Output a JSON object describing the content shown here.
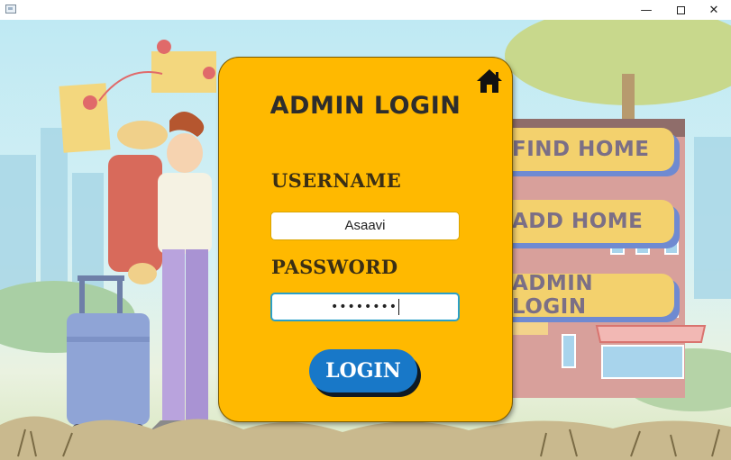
{
  "window": {
    "minimize_glyph": "—",
    "close_glyph": "✕"
  },
  "background_signs": [
    {
      "label": "FIND HOME"
    },
    {
      "label": "ADD HOME"
    },
    {
      "label": "ADMIN LOGIN"
    }
  ],
  "login_card": {
    "title": "ADMIN LOGIN",
    "username_label": "USERNAME",
    "username_value": "Asaavi",
    "password_label": "PASSWORD",
    "password_masked": "••••••••",
    "login_label": "LOGIN",
    "home_icon": "home-icon"
  },
  "colors": {
    "card": "#ffb900",
    "login_button": "#1878c8",
    "sign": "#f3d16d",
    "sign_shadow": "#6f8ad1"
  }
}
